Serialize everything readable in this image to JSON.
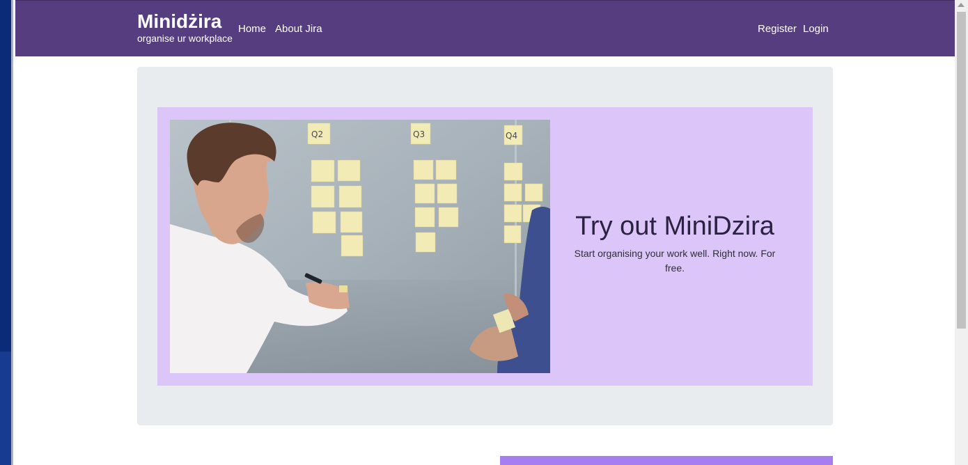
{
  "navbar": {
    "brand_title": "Minidżira",
    "brand_subtitle": "organise ur workplace",
    "links": {
      "home": "Home",
      "about": "About Jira",
      "register": "Register",
      "login": "Login"
    },
    "bg_color": "#553d80"
  },
  "hero": {
    "title": "Try out MiniDzira",
    "description": "Start organising your work well. Right now. For free.",
    "image": {
      "alt": "man-writing-sticky-notes-on-glass-wall",
      "columns": [
        "Q2",
        "Q3",
        "Q4"
      ]
    },
    "bg_color": "#dbc5f9"
  },
  "colors": {
    "jumbotron_bg": "#e8ecef",
    "accent": "#a77ef0"
  }
}
